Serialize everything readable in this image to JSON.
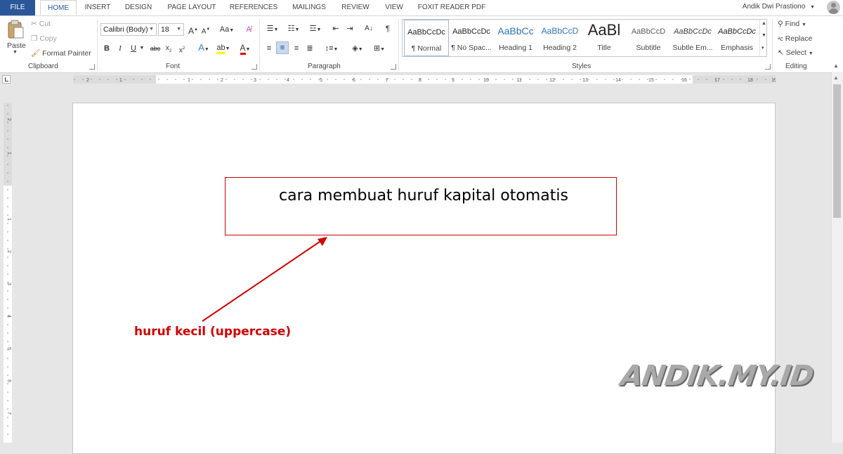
{
  "tabs": [
    {
      "label": "FILE"
    },
    {
      "label": "HOME"
    },
    {
      "label": "INSERT"
    },
    {
      "label": "DESIGN"
    },
    {
      "label": "PAGE LAYOUT"
    },
    {
      "label": "REFERENCES"
    },
    {
      "label": "MAILINGS"
    },
    {
      "label": "REVIEW"
    },
    {
      "label": "VIEW"
    },
    {
      "label": "FOXIT READER PDF"
    }
  ],
  "user": {
    "name": "Andik Dwi Prastiono"
  },
  "clipboard": {
    "paste": "Paste",
    "cut": "Cut",
    "copy": "Copy",
    "format_painter": "Format Painter",
    "label": "Clipboard"
  },
  "font": {
    "family": "Calibri (Body)",
    "size": "18",
    "label": "Font"
  },
  "paragraph": {
    "label": "Paragraph"
  },
  "styles": {
    "label": "Styles",
    "items": [
      {
        "preview": "AaBbCcDc",
        "name": "¶ Normal"
      },
      {
        "preview": "AaBbCcDc",
        "name": "¶ No Spac..."
      },
      {
        "preview": "AaBbCc",
        "name": "Heading 1"
      },
      {
        "preview": "AaBbCcD",
        "name": "Heading 2"
      },
      {
        "preview": "AaBl",
        "name": "Title"
      },
      {
        "preview": "AaBbCcD",
        "name": "Subtitle"
      },
      {
        "preview": "AaBbCcDc",
        "name": "Subtle Em..."
      },
      {
        "preview": "AaBbCcDc",
        "name": "Emphasis"
      }
    ]
  },
  "editing": {
    "find": "Find",
    "replace": "Replace",
    "select": "Select",
    "label": "Editing"
  },
  "ruler": {
    "h_ticks": [
      "2",
      "1",
      "1",
      "2",
      "3",
      "4",
      "5",
      "6",
      "7",
      "8",
      "9",
      "10",
      "11",
      "12",
      "13",
      "14",
      "15",
      "16",
      "17",
      "18",
      "19"
    ],
    "v_ticks": [
      "2",
      "1",
      "1",
      "2",
      "3",
      "4",
      "5",
      "6",
      "7"
    ]
  },
  "document": {
    "text": "cara membuat huruf kapital otomatis"
  },
  "annotation": {
    "text": "huruf kecil (uppercase)"
  },
  "watermark": {
    "text": "ANDIK.MY.ID"
  },
  "colors": {
    "file_tab": "#2b579a",
    "annotation": "#d20000",
    "watermark": "#a9a9a9"
  }
}
